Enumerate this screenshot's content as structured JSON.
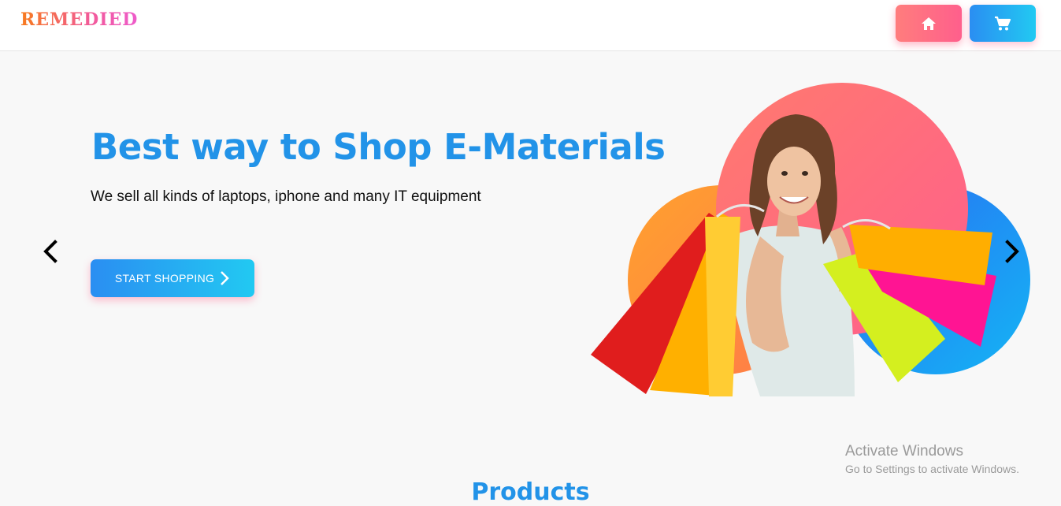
{
  "header": {
    "logo": "REMEDIED",
    "home_icon": "home-icon",
    "cart_icon": "cart-icon"
  },
  "hero": {
    "title": "Best way to Shop E-Materials",
    "subtitle": "We sell all kinds of laptops, iphone and many IT equipment",
    "cta_label": "START SHOPPING",
    "cta_icon": "chevron-right-icon",
    "prev_icon": "chevron-left-icon",
    "next_icon": "chevron-right-icon",
    "image": "woman-with-shopping-bags"
  },
  "watermark": {
    "line1": "Activate Windows",
    "line2": "Go to Settings to activate Windows."
  },
  "section": {
    "title": "Products"
  },
  "colors": {
    "primary_blue": "#2293e8",
    "gradient_orange": "#f77b1d",
    "gradient_pink": "#ff5f8c",
    "gradient_cyan": "#22c9f2"
  }
}
